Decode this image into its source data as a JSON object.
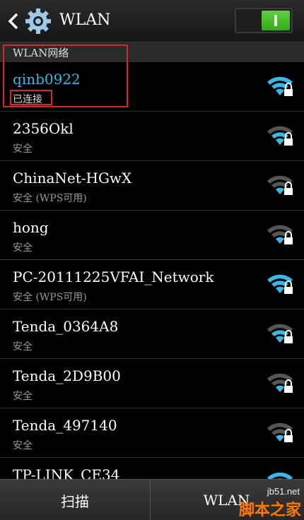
{
  "actionbar": {
    "title": "WLAN",
    "toggle_state": "on"
  },
  "section": {
    "label": "WLAN网络"
  },
  "networks": [
    {
      "ssid": "qinb0922",
      "status": "已连接",
      "signal": "full",
      "connected": true
    },
    {
      "ssid": "2356Okl",
      "status": "安全",
      "signal": "medium",
      "connected": false
    },
    {
      "ssid": "ChinaNet-HGwX",
      "status": "安全 (WPS可用)",
      "signal": "medium",
      "connected": false
    },
    {
      "ssid": "hong",
      "status": "安全",
      "signal": "medium",
      "connected": false
    },
    {
      "ssid": "PC-20111225VFAI_Network",
      "status": "安全 (WPS可用)",
      "signal": "full",
      "connected": false
    },
    {
      "ssid": "Tenda_0364A8",
      "status": "安全",
      "signal": "medium",
      "connected": false
    },
    {
      "ssid": "Tenda_2D9B00",
      "status": "安全",
      "signal": "medium",
      "connected": false
    },
    {
      "ssid": "Tenda_497140",
      "status": "安全",
      "signal": "medium",
      "connected": false
    },
    {
      "ssid": "TP-LINK_CE34",
      "status": "",
      "signal": "full",
      "connected": false
    }
  ],
  "bottombar": {
    "scan_label": "扫描",
    "wlan_label": "WLAN"
  },
  "watermark": {
    "url": "jb51.net",
    "name": "脚本之家"
  },
  "colors": {
    "accent": "#3ab7e6",
    "toggle_on": "#4cc22b",
    "annotation": "#d8262c",
    "watermark": "#ff7a00"
  }
}
